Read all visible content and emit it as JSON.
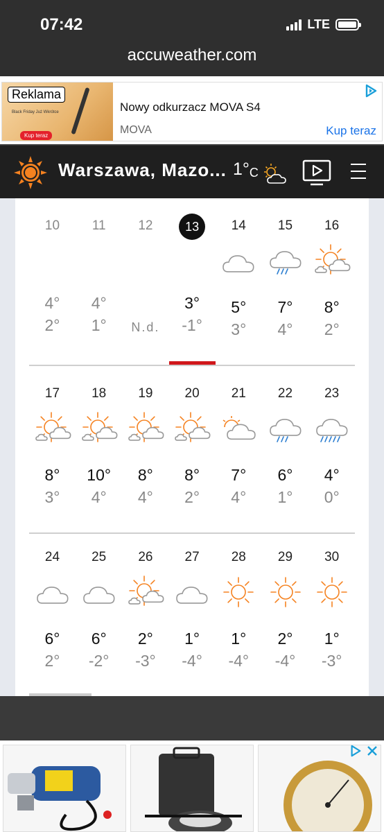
{
  "status": {
    "time": "07:42",
    "network": "LTE"
  },
  "browser": {
    "url": "accuweather.com"
  },
  "ad_banner": {
    "label": "Reklama",
    "title": "Nowy odkurzacz MOVA S4",
    "brand": "MOVA",
    "cta": "Kup teraz",
    "image_small_text": "Black Friday Już Wkrótce",
    "image_button": "Kup teraz"
  },
  "header": {
    "city": "Warszawa, Mazo...",
    "current_temp": "1°",
    "unit": "C",
    "current_icon": "partly-cloudy-icon"
  },
  "weeks": [
    [
      {
        "day": "10",
        "icon": "",
        "hi": "4°",
        "lo": "2°",
        "state": "past"
      },
      {
        "day": "11",
        "icon": "",
        "hi": "4°",
        "lo": "1°",
        "state": "past"
      },
      {
        "day": "12",
        "icon": "",
        "hi": "",
        "lo": "N.d.",
        "state": "past"
      },
      {
        "day": "13",
        "icon": "",
        "hi": "3°",
        "lo": "-1°",
        "state": "today"
      },
      {
        "day": "14",
        "icon": "cloudy",
        "hi": "5°",
        "lo": "3°",
        "state": "future"
      },
      {
        "day": "15",
        "icon": "rain",
        "hi": "7°",
        "lo": "4°",
        "state": "future"
      },
      {
        "day": "16",
        "icon": "sun-cloud",
        "hi": "8°",
        "lo": "2°",
        "state": "future"
      }
    ],
    [
      {
        "day": "17",
        "icon": "sun-cloud",
        "hi": "8°",
        "lo": "3°",
        "state": "future"
      },
      {
        "day": "18",
        "icon": "sun-cloud",
        "hi": "10°",
        "lo": "4°",
        "state": "future"
      },
      {
        "day": "19",
        "icon": "sun-cloud",
        "hi": "8°",
        "lo": "4°",
        "state": "future"
      },
      {
        "day": "20",
        "icon": "sun-cloud",
        "hi": "8°",
        "lo": "2°",
        "state": "future"
      },
      {
        "day": "21",
        "icon": "cloud-sun",
        "hi": "7°",
        "lo": "4°",
        "state": "future"
      },
      {
        "day": "22",
        "icon": "rain",
        "hi": "6°",
        "lo": "1°",
        "state": "future"
      },
      {
        "day": "23",
        "icon": "rain-heavy",
        "hi": "4°",
        "lo": "0°",
        "state": "future"
      }
    ],
    [
      {
        "day": "24",
        "icon": "cloudy",
        "hi": "6°",
        "lo": "2°",
        "state": "future"
      },
      {
        "day": "25",
        "icon": "cloudy",
        "hi": "6°",
        "lo": "-2°",
        "state": "future"
      },
      {
        "day": "26",
        "icon": "sun-cloud",
        "hi": "2°",
        "lo": "-3°",
        "state": "future"
      },
      {
        "day": "27",
        "icon": "cloudy",
        "hi": "1°",
        "lo": "-4°",
        "state": "future"
      },
      {
        "day": "28",
        "icon": "sunny",
        "hi": "1°",
        "lo": "-4°",
        "state": "future"
      },
      {
        "day": "29",
        "icon": "sunny",
        "hi": "2°",
        "lo": "-4°",
        "state": "future"
      },
      {
        "day": "30",
        "icon": "sunny",
        "hi": "1°",
        "lo": "-3°",
        "state": "future"
      }
    ]
  ],
  "colors": {
    "accent": "#f58220",
    "today_bar": "#d0171b",
    "rain": "#2f80d1",
    "ad_link": "#1a73e8"
  }
}
